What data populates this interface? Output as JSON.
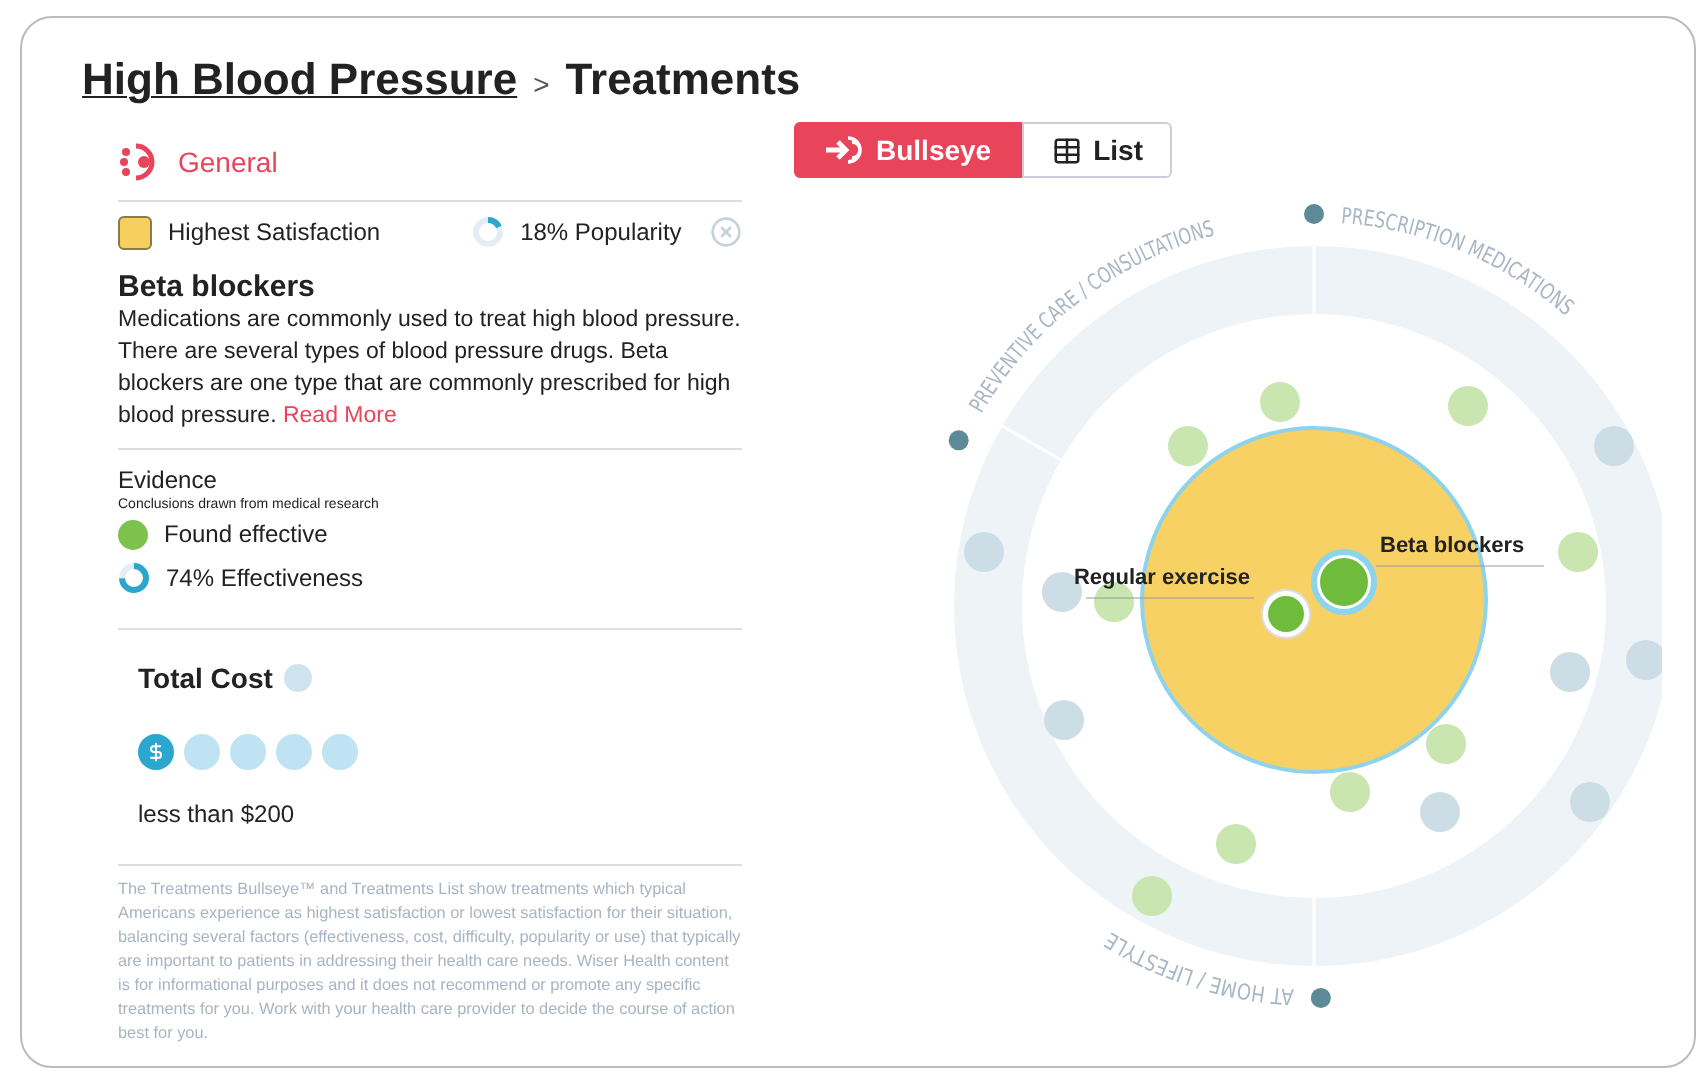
{
  "breadcrumb": {
    "parent": "High Blood Pressure",
    "separator": ">",
    "current": "Treatments"
  },
  "category_tab": {
    "label": "General"
  },
  "legend": {
    "satisfaction": "Highest Satisfaction",
    "popularity": {
      "reading": "18% Popularity",
      "level": 0.18
    }
  },
  "treatment": {
    "name": "Beta blockers",
    "description": "Medications are commonly used to treat high blood pressure. There are several types of blood pressure drugs. Beta blockers are one type that are commonly prescribed for high blood pressure.",
    "link": "Read More"
  },
  "evidence": {
    "title": "Evidence",
    "subtitle": "Conclusions drawn from medical research",
    "finding": "Found effective",
    "effectiveness": {
      "reading": "74% Effectiveness",
      "level": 0.74
    }
  },
  "cost": {
    "title": "Total Cost",
    "stars": 1,
    "reading": "less than $200"
  },
  "disclaimer": "The Treatments Bullseye™ and Treatments List show treatments which typical Americans experience as highest satisfaction or lowest satisfaction for their situation, balancing several factors (effectiveness, cost, difficulty, popularity or use) that typically are important to patients in addressing their health care needs. Wiser Health content is for informational purposes and it does not recommend or promote any specific treatments for you. Work with your health care provider to decide the course of action best for you.",
  "view_tabs": [
    {
      "label": "Bullseye",
      "kind": "bullseye",
      "selected": true
    },
    {
      "label": "List",
      "kind": "list",
      "selected": false
    }
  ],
  "bullseye": {
    "sectors": [
      "PREVENTIVE CARE / CONSULTATIONS",
      "PRESCRIPTION MEDICATIONS",
      "AT HOME / LIFESTYLE"
    ],
    "labeled_treatments": [
      {
        "label": "Beta blockers",
        "selected": true
      },
      {
        "label": "Regular exercise",
        "selected": false
      }
    ]
  }
}
